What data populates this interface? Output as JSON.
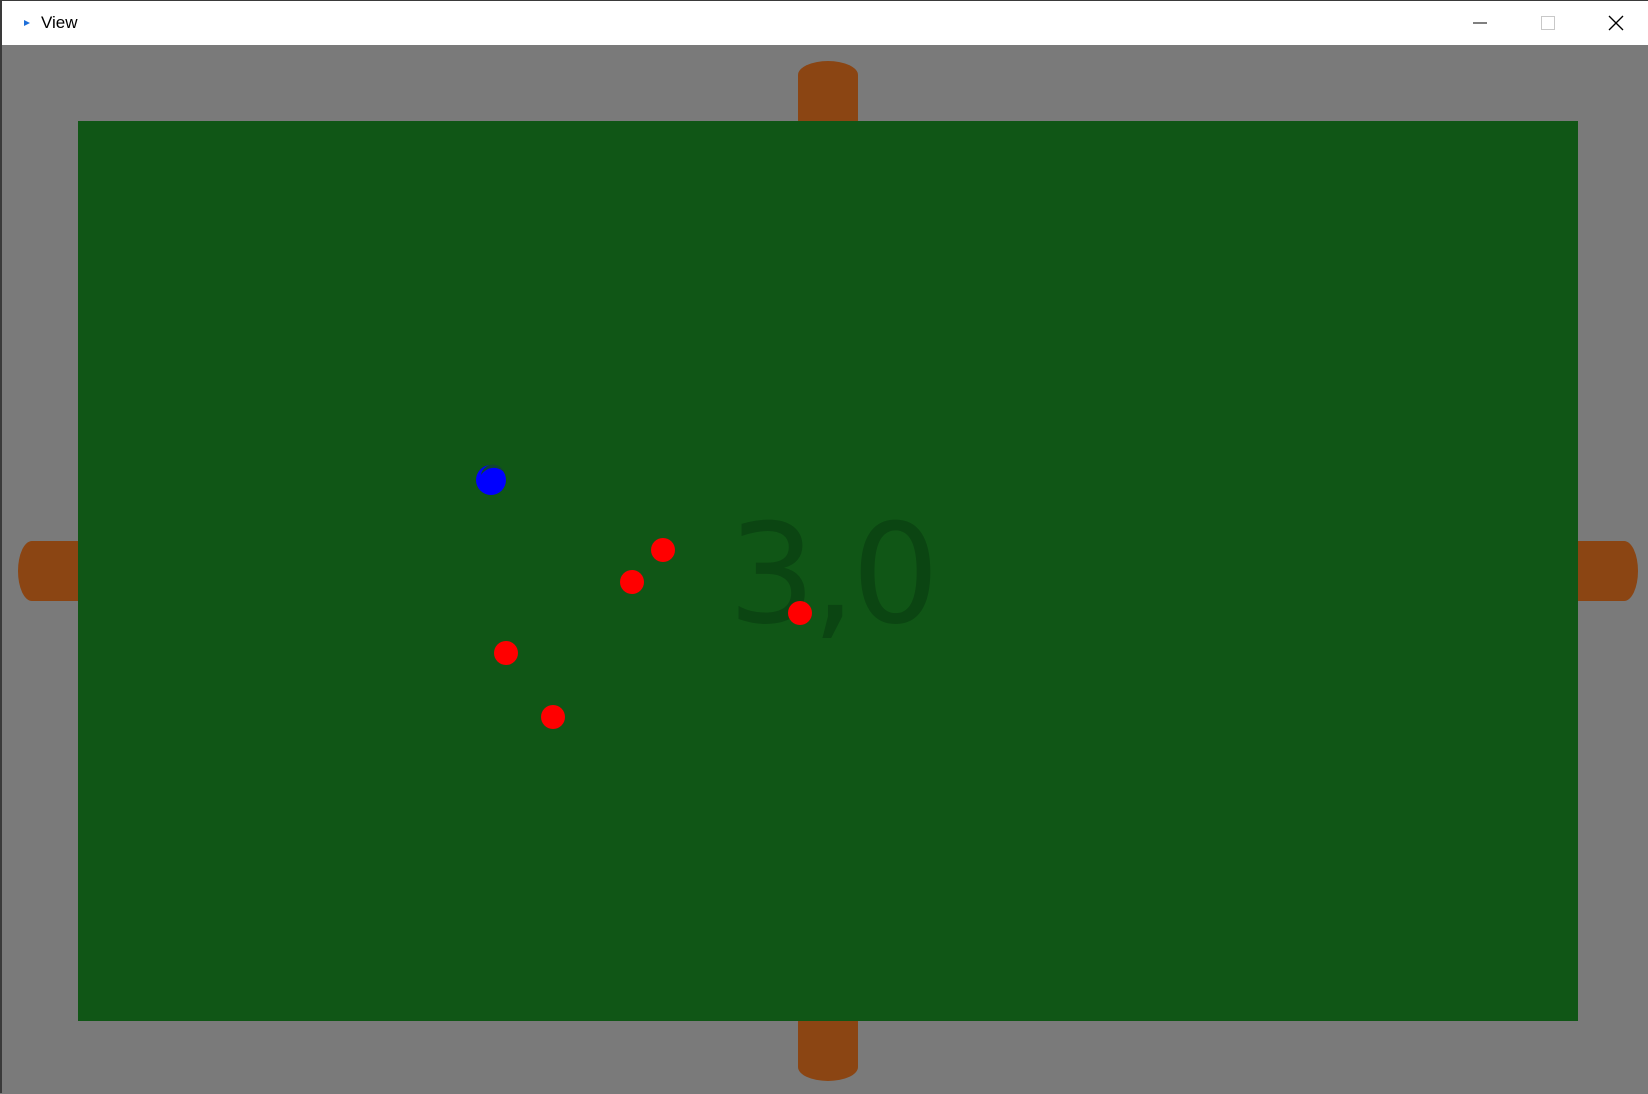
{
  "window": {
    "title": "View",
    "icon": "play-arrow-icon",
    "controls": [
      "minimize-icon",
      "maximize-icon",
      "close-icon"
    ]
  },
  "colors": {
    "background": "#7a7a7a",
    "table": "#105616",
    "pocket": "#8b4513",
    "score_text": "#0b4512",
    "ball_red": "#ff0000",
    "ball_blue": "#0000ff",
    "ball_blue_shade": "#114433"
  },
  "game": {
    "score": "3,0"
  }
}
